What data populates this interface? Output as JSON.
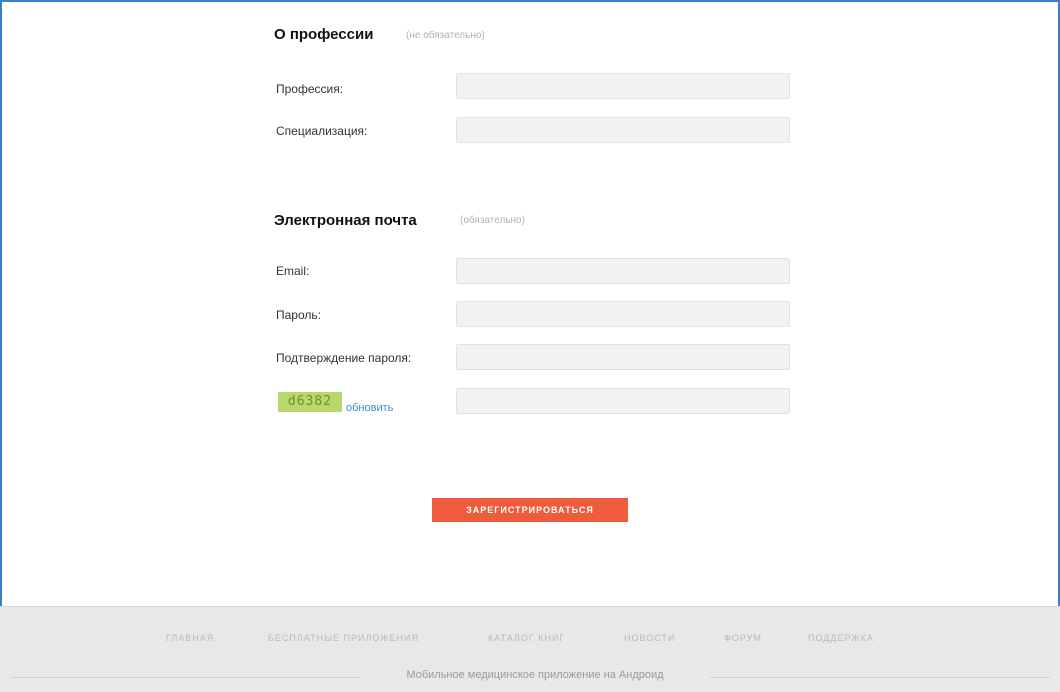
{
  "profession_section": {
    "title": "О профессии",
    "note": "(не обязательно)",
    "profession_label": "Профессия:",
    "profession_value": "",
    "specialization_label": "Специализация:",
    "specialization_value": ""
  },
  "email_section": {
    "title": "Электронная почта",
    "note": "(обязательно)",
    "email_label": "Email:",
    "email_value": "",
    "password_label": "Пароль:",
    "password_value": "",
    "confirm_label": "Подтверждение пароля:",
    "confirm_value": ""
  },
  "captcha": {
    "code": "d6382",
    "refresh_label": "обновить",
    "value": ""
  },
  "submit_label": "ЗАРЕГИСТРИРОВАТЬСЯ",
  "footer": {
    "nav": [
      "ГЛАВНАЯ",
      "БЕСПЛАТНЫЕ ПРИЛОЖЕНИЯ",
      "КАТАЛОГ КНИГ",
      "НОВОСТИ",
      "ФОРУМ",
      "ПОДДЕРЖКА"
    ],
    "tagline": "Мобильное медицинское приложение на Андроид"
  },
  "colors": {
    "accent": "#ef5b3d",
    "link": "#3a8fd0",
    "captcha_bg": "#b9d86b",
    "frame": "#3a7bd5"
  }
}
